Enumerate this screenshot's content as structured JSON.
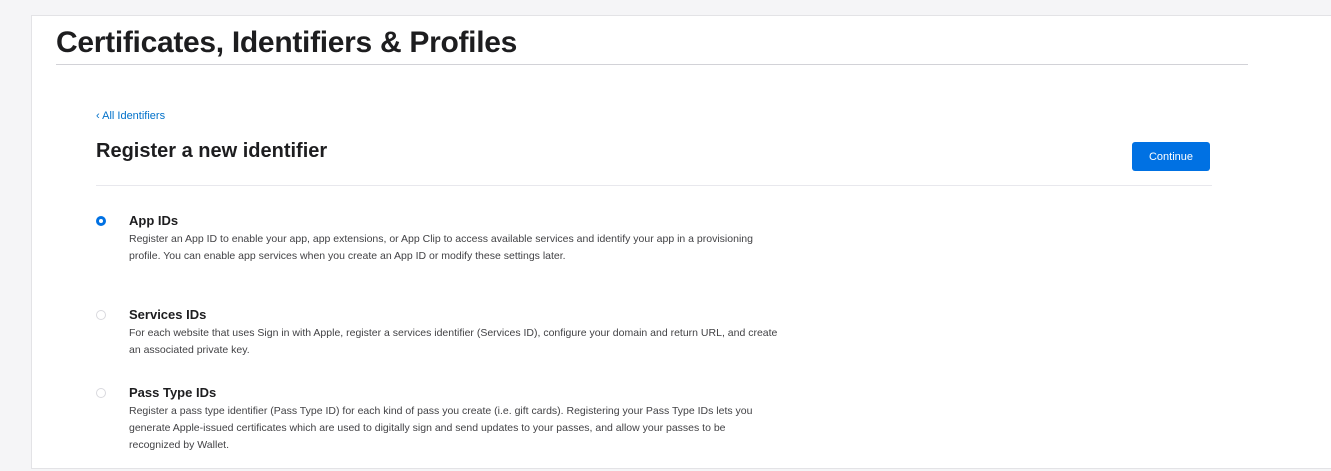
{
  "page": {
    "title": "Certificates, Identifiers & Profiles"
  },
  "nav": {
    "back_link": "‹ All Identifiers"
  },
  "section": {
    "title": "Register a new identifier",
    "continue_label": "Continue"
  },
  "colors": {
    "accent": "#0071e3",
    "link": "#0070c9"
  },
  "options": [
    {
      "title": "App IDs",
      "description": "Register an App ID to enable your app, app extensions, or App Clip to access available services and identify your app in a provisioning profile. You can enable app services when you create an App ID or modify these settings later.",
      "selected": true
    },
    {
      "title": "Services IDs",
      "description": "For each website that uses Sign in with Apple, register a services identifier (Services ID), configure your domain and return URL, and create an associated private key.",
      "selected": false
    },
    {
      "title": "Pass Type IDs",
      "description": "Register a pass type identifier (Pass Type ID) for each kind of pass you create (i.e. gift cards). Registering your Pass Type IDs lets you generate Apple-issued certificates which are used to digitally sign and send updates to your passes, and allow your passes to be recognized by Wallet.",
      "selected": false
    }
  ]
}
